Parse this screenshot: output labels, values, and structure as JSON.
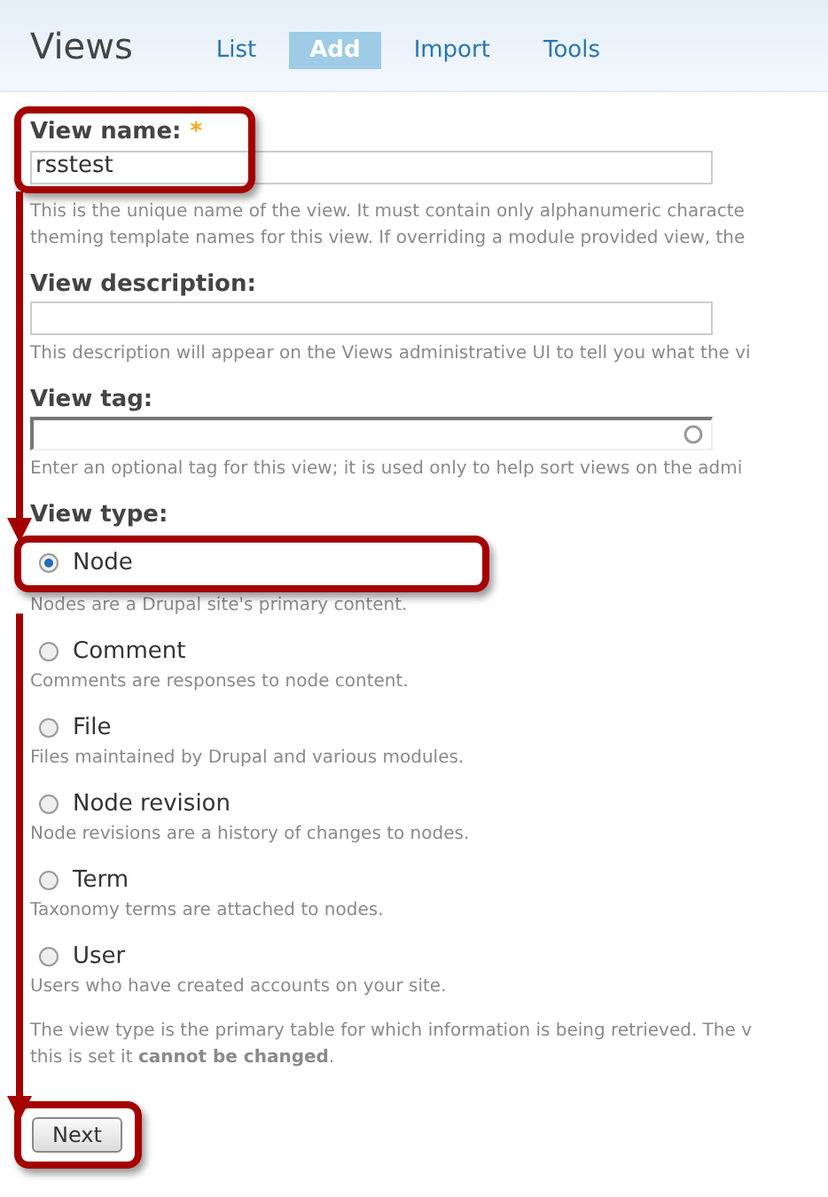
{
  "header": {
    "title": "Views",
    "tabs": [
      {
        "label": "List",
        "selected": false
      },
      {
        "label": "Add",
        "selected": true
      },
      {
        "label": "Import",
        "selected": false
      },
      {
        "label": "Tools",
        "selected": false
      }
    ]
  },
  "fields": [
    {
      "kind": "text",
      "label": "View name:",
      "required_mark": "*",
      "value": "rsstest",
      "help_lines": [
        "This is the unique name of the view. It must contain only alphanumeric characte",
        "theming template names for this view. If overriding a module provided view, the"
      ]
    },
    {
      "kind": "text",
      "label": "View description:",
      "help_lines": [
        "This description will appear on the Views administrative UI to tell you what the vi"
      ]
    },
    {
      "kind": "autocomplete",
      "label": "View tag:",
      "help_lines": [
        "Enter an optional tag for this view; it is used only to help sort views on the admi"
      ]
    }
  ],
  "view_type": {
    "label": "View type:",
    "options": [
      {
        "label": "Node",
        "description": "Nodes are a Drupal site's primary content.",
        "selected": true
      },
      {
        "label": "Comment",
        "description": "Comments are responses to node content.",
        "selected": false
      },
      {
        "label": "File",
        "description": "Files maintained by Drupal and various modules.",
        "selected": false
      },
      {
        "label": "Node revision",
        "description": "Node revisions are a history of changes to nodes.",
        "selected": false
      },
      {
        "label": "Term",
        "description": "Taxonomy terms are attached to nodes.",
        "selected": false
      },
      {
        "label": "User",
        "description": "Users who have created accounts on your site.",
        "selected": false
      }
    ],
    "help_lines": [
      "The view type is the primary table for which information is being retrieved. The v",
      "this is set it **cannot be changed**."
    ]
  },
  "buttons": [
    {
      "label": "Next"
    }
  ]
}
